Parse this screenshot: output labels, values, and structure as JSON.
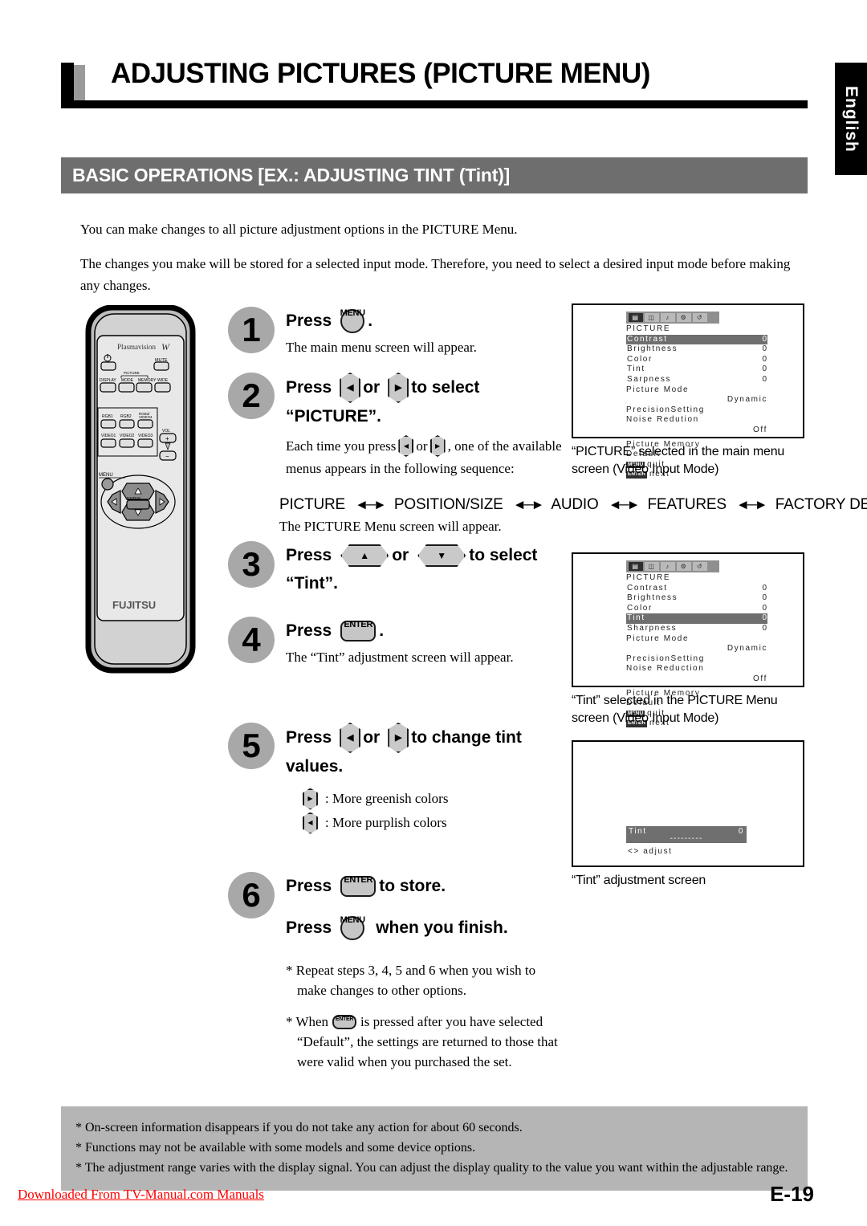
{
  "page": {
    "title": "ADJUSTING PICTURES (PICTURE MENU)",
    "section_band": "BASIC OPERATIONS [EX.: ADJUSTING TINT (Tint)]",
    "language_tab": "English",
    "page_number": "E-19",
    "watermark": "Downloaded From TV-Manual.com Manuals"
  },
  "intro": {
    "p1": "You can make changes to all picture adjustment options in the PICTURE Menu.",
    "p2": "The changes you make will be stored for a selected input mode.  Therefore, you need to select a desired input mode before making any changes."
  },
  "remote": {
    "brand": "Plasmavision",
    "brand_mark": "W",
    "footer_brand": "FUJITSU",
    "power_icon": "power-icon",
    "buttons": {
      "mute": "MUTE",
      "display": "DISPLAY",
      "picture_group": "PICTURE",
      "mode": "MODE",
      "memory": "MEMORY",
      "wide": "WIDE",
      "rgb1": "RGB1",
      "rgb2": "RGB2",
      "rgb3_video4": "RGB3/VIDEO4",
      "video1": "VIDEO1",
      "video2": "VIDEO2",
      "video3": "VIDEO3",
      "vol": "VOL",
      "vol_plus": "+",
      "vol_minus": "–",
      "menu": "MENU",
      "enter": "ENTER"
    }
  },
  "steps": [
    {
      "num": "1",
      "head_pre": "Press",
      "key": "MENU",
      "head_post": ".",
      "sub": "The main menu screen will appear."
    },
    {
      "num": "2",
      "head_pre": "Press",
      "head_mid": "or",
      "head_post": "to select",
      "head_line2": "“PICTURE”.",
      "sub_a": "Each time you press",
      "sub_b": "or",
      "sub_c": ", one of the available",
      "sub_d": "menus appears in the following sequence:"
    },
    {
      "num": "3",
      "head_pre": "Press",
      "head_mid": "or",
      "head_post": "to select",
      "head_line2": "“Tint”."
    },
    {
      "num": "4",
      "head_pre": "Press",
      "key": "ENTER",
      "head_post": ".",
      "sub": "The “Tint” adjustment screen will appear."
    },
    {
      "num": "5",
      "head_pre": "Press",
      "head_mid": "or",
      "head_post": "to change tint",
      "head_line2": "values.",
      "bullet_right": ": More greenish colors",
      "bullet_left": ": More purplish colors"
    },
    {
      "num": "6",
      "head_pre": "Press",
      "key": "ENTER",
      "head_post": "to store.",
      "head2_pre": "Press",
      "key2": "MENU",
      "head2_post": "when you finish.",
      "note1": "* Repeat steps 3, 4, 5 and 6 when you wish to",
      "note1b": "make changes to other options.",
      "note2a": "* When",
      "note2b": "is pressed after you have selected",
      "note2c": "“Default”, the settings are returned to those that",
      "note2d": "were valid when you purchased the set."
    }
  ],
  "menu_sequence": {
    "items": [
      "PICTURE",
      "POSITION/SIZE",
      "AUDIO",
      "FEATURES",
      "FACTORY DEFAULT"
    ],
    "separator": "◄─►",
    "note": "The PICTURE Menu screen will appear."
  },
  "osd_screens": [
    {
      "id": "picture-menu-contrast",
      "tabs": [
        "picture-tab-icon",
        "position-size-tab-icon",
        "audio-tab-icon",
        "features-tab-icon",
        "factory-default-tab-icon"
      ],
      "selected_tab": 0,
      "title": "PICTURE",
      "rows": [
        {
          "label": "Contrast",
          "value": "0",
          "highlighted": true
        },
        {
          "label": "Brightness",
          "value": "0",
          "highlighted": false
        },
        {
          "label": "Color",
          "value": "0",
          "highlighted": false
        },
        {
          "label": "Tint",
          "value": "0",
          "highlighted": false
        },
        {
          "label": "Sarpness",
          "value": "0",
          "highlighted": false
        }
      ],
      "picture_mode_label": "Picture Mode",
      "picture_mode_value": "Dynamic",
      "precision_setting": "PrecisionSetting",
      "noise_reduction_label": "Noise Redution",
      "noise_reduction_value": "Off",
      "picture_memory": "Picture Memory",
      "default": "Default",
      "quit_badge": "MENU",
      "quit_text": "quit",
      "next_badge": "ENTER",
      "next_text": "next",
      "caption_l1": "“PICTURE” selected in the main menu",
      "caption_l2": "screen (Video Input Mode)"
    },
    {
      "id": "picture-menu-tint",
      "tabs": [
        "picture-tab-icon",
        "position-size-tab-icon",
        "audio-tab-icon",
        "features-tab-icon",
        "factory-default-tab-icon"
      ],
      "selected_tab": 0,
      "title": "PICTURE",
      "rows": [
        {
          "label": "Contrast",
          "value": "0",
          "highlighted": false
        },
        {
          "label": "Brightness",
          "value": "0",
          "highlighted": false
        },
        {
          "label": "Color",
          "value": "0",
          "highlighted": false
        },
        {
          "label": "Tint",
          "value": "0",
          "highlighted": true
        },
        {
          "label": "Sharpness",
          "value": "0",
          "highlighted": false
        }
      ],
      "picture_mode_label": "Picture Mode",
      "picture_mode_value": "Dynamic",
      "precision_setting": "PrecisionSetting",
      "noise_reduction_label": "Noise Reduction",
      "noise_reduction_value": "Off",
      "picture_memory": "Picture Memory",
      "default": "Default",
      "quit_badge": "MENU",
      "quit_text": "quit",
      "next_badge": "ENTER",
      "next_text": "next",
      "caption_l1": "“Tint” selected in the PICTURE Menu",
      "caption_l2": "screen (Video Input Mode)"
    },
    {
      "id": "tint-adjust",
      "bar_label": "Tint",
      "bar_value": "0",
      "bar_dashes": "---------",
      "adjust_hint": "<> adjust",
      "caption_l1": "“Tint” adjustment screen"
    }
  ],
  "footer_notes": [
    "* On-screen information disappears if you do not take any action for about 60 seconds.",
    "* Functions may not be available with some models and some device options.",
    "* The adjustment range varies with the display signal. You can adjust the display quality to the value you want within the adjustable range."
  ]
}
